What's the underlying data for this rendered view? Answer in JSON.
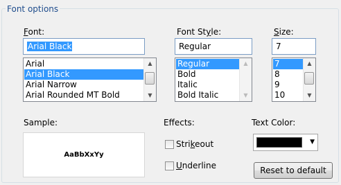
{
  "group": {
    "title": "Font options"
  },
  "font": {
    "label": "Font:",
    "label_underline": "F",
    "label_rest": "ont:",
    "value": "Arial Black",
    "items": [
      "Arial",
      "Arial Black",
      "Arial Narrow",
      "Arial Rounded MT Bold"
    ],
    "selected_index": 1
  },
  "style": {
    "label": "Font Style:",
    "label_pre": "Font St",
    "label_underline": "y",
    "label_post": "le:",
    "value": "Regular",
    "items": [
      "Regular",
      "Bold",
      "Italic",
      "Bold Italic"
    ],
    "selected_index": 0
  },
  "size": {
    "label": "Size:",
    "label_underline": "S",
    "label_rest": "ize:",
    "value": "7",
    "items": [
      "7",
      "8",
      "9",
      "10"
    ],
    "selected_index": 0
  },
  "sample": {
    "label": "Sample:",
    "text": "AaBbXxYy"
  },
  "effects": {
    "label": "Effects:",
    "strikeout": {
      "label": "Strikeout",
      "pre": "Stri",
      "underline": "k",
      "post": "eout",
      "checked": false
    },
    "underline": {
      "label": "Underline",
      "pre": "",
      "underline": "U",
      "post": "nderline",
      "checked": false
    }
  },
  "text_color": {
    "label": "Text Color:",
    "value": "#000000"
  },
  "reset_button": {
    "label": "Reset to default"
  },
  "colors": {
    "selection": "#3399ff",
    "group_title": "#1e4c8c",
    "background": "#f0f0f0"
  }
}
